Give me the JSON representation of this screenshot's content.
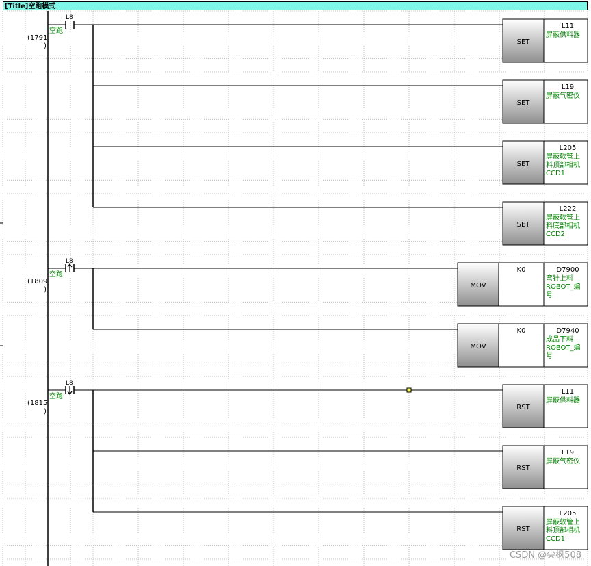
{
  "title": "[Title]空跑模式",
  "watermark": "CSDN @尖枫508",
  "colors": {
    "comment": "#008000",
    "titlebar": "#7ff7e8",
    "grid": "#c0c0c0"
  },
  "blocks": [
    {
      "step": "(1791",
      "step_close": ")",
      "contact": {
        "device": "L8",
        "comment": "空跑",
        "type": "no"
      },
      "outputs": [
        {
          "instr": "SET",
          "device": "L11",
          "comment": [
            "屏蔽供料器"
          ]
        },
        {
          "instr": "SET",
          "device": "L19",
          "comment": [
            "屏蔽气密仪"
          ]
        },
        {
          "instr": "SET",
          "device": "L205",
          "comment": [
            "屏蔽软管上",
            "料顶部相机",
            "CCD1"
          ]
        },
        {
          "instr": "SET",
          "device": "L222",
          "comment": [
            "屏蔽软管上",
            "料底部相机",
            "CCD2"
          ]
        }
      ]
    },
    {
      "step": "(1809",
      "step_close": ")",
      "contact": {
        "device": "L8",
        "comment": "空跑",
        "type": "rising"
      },
      "outputs": [
        {
          "instr": "MOV",
          "src": "K0",
          "device": "D7900",
          "comment": [
            "弯针上料",
            "ROBOT_编",
            "号"
          ]
        },
        {
          "instr": "MOV",
          "src": "K0",
          "device": "D7940",
          "comment": [
            "成品下料",
            "ROBOT_编",
            "号"
          ]
        }
      ]
    },
    {
      "step": "(1815",
      "step_close": ")",
      "contact": {
        "device": "L8",
        "comment": "空跑",
        "type": "falling"
      },
      "outputs": [
        {
          "instr": "RST",
          "device": "L11",
          "comment": [
            "屏蔽供料器"
          ]
        },
        {
          "instr": "RST",
          "device": "L19",
          "comment": [
            "屏蔽气密仪"
          ]
        },
        {
          "instr": "RST",
          "device": "L205",
          "comment": [
            "屏蔽软管上",
            "料顶部相机",
            "CCD1"
          ]
        }
      ]
    }
  ]
}
